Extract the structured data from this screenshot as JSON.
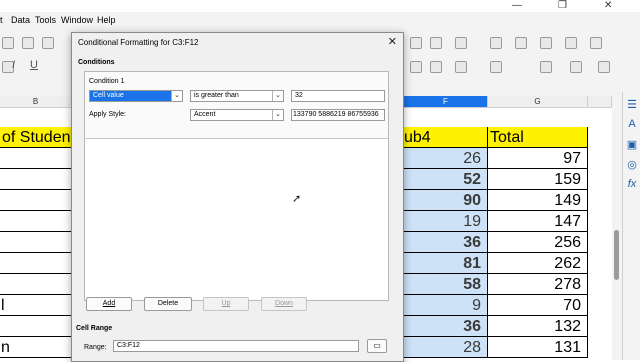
{
  "menubar": {
    "items": [
      "t",
      "Data",
      "Tools",
      "Window",
      "Help"
    ]
  },
  "window_controls": {
    "minimize": "—",
    "restore": "❐",
    "close": "✕"
  },
  "columns": {
    "B": "B",
    "F": "F",
    "G": "G"
  },
  "sheet": {
    "header_b": "of Students",
    "header_f": "ub4",
    "header_g": "Total",
    "col_b": [
      "",
      "",
      "",
      "",
      "",
      "",
      "",
      "l",
      "",
      "n"
    ],
    "rows": [
      {
        "f": "26",
        "f_bold": false,
        "g": "97"
      },
      {
        "f": "52",
        "f_bold": true,
        "g": "159"
      },
      {
        "f": "90",
        "f_bold": true,
        "g": "149"
      },
      {
        "f": "19",
        "f_bold": false,
        "g": "147"
      },
      {
        "f": "36",
        "f_bold": true,
        "g": "256"
      },
      {
        "f": "81",
        "f_bold": true,
        "g": "262"
      },
      {
        "f": "58",
        "f_bold": true,
        "g": "278"
      },
      {
        "f": "9",
        "f_bold": false,
        "g": "70"
      },
      {
        "f": "36",
        "f_bold": true,
        "g": "132"
      },
      {
        "f": "28",
        "f_bold": false,
        "g": "131"
      }
    ]
  },
  "dialog": {
    "title": "Conditional Formatting for C3:F12",
    "conditions_label": "Conditions",
    "condition1_label": "Condition 1",
    "type_select": "Cell value",
    "operator_select": "is greater than",
    "value_input": "32",
    "apply_style_label": "Apply Style:",
    "style_select": "Accent",
    "preview_text": "133790 5886219 86755936",
    "add_button": "Add",
    "delete_button": "Delete",
    "up_button": "Up",
    "down_button": "Down",
    "cell_range_label": "Cell Range",
    "range_label": "Range:",
    "range_input": "C3:F12"
  },
  "sidebar_icons": [
    "properties-icon",
    "styles-icon",
    "gallery-icon",
    "navigator-icon",
    "functions-icon"
  ]
}
